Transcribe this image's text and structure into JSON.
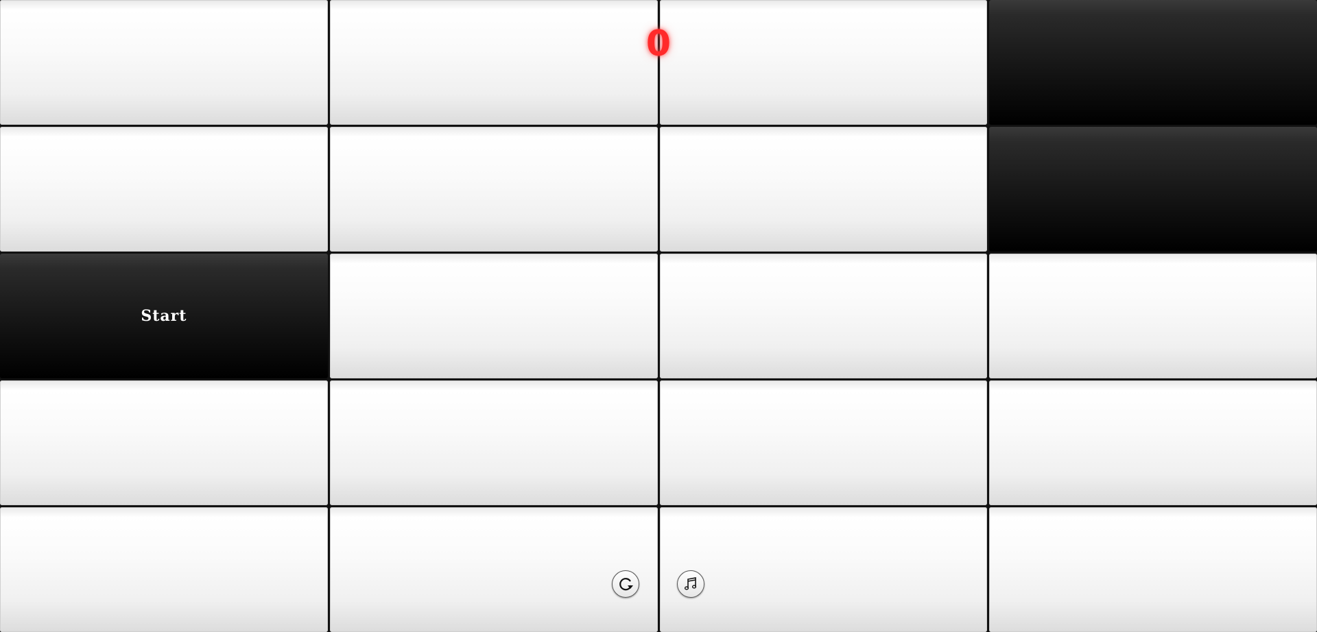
{
  "game": {
    "score": "0",
    "start_label": "Start",
    "grid": {
      "rows": 5,
      "cols": 4,
      "tiles": [
        [
          "white",
          "white",
          "white",
          "black"
        ],
        [
          "white",
          "white",
          "white",
          "black"
        ],
        [
          "black",
          "white",
          "white",
          "white"
        ],
        [
          "white",
          "white",
          "white",
          "white"
        ],
        [
          "white",
          "white",
          "white",
          "white"
        ]
      ],
      "start_tile": {
        "row": 2,
        "col": 0
      }
    },
    "controls": {
      "restart_icon": "restart-icon",
      "music_icon": "music-note-icon"
    },
    "colors": {
      "score": "#ff2a2a",
      "black_tile": "#000000",
      "white_tile": "#f5f5f5"
    }
  }
}
